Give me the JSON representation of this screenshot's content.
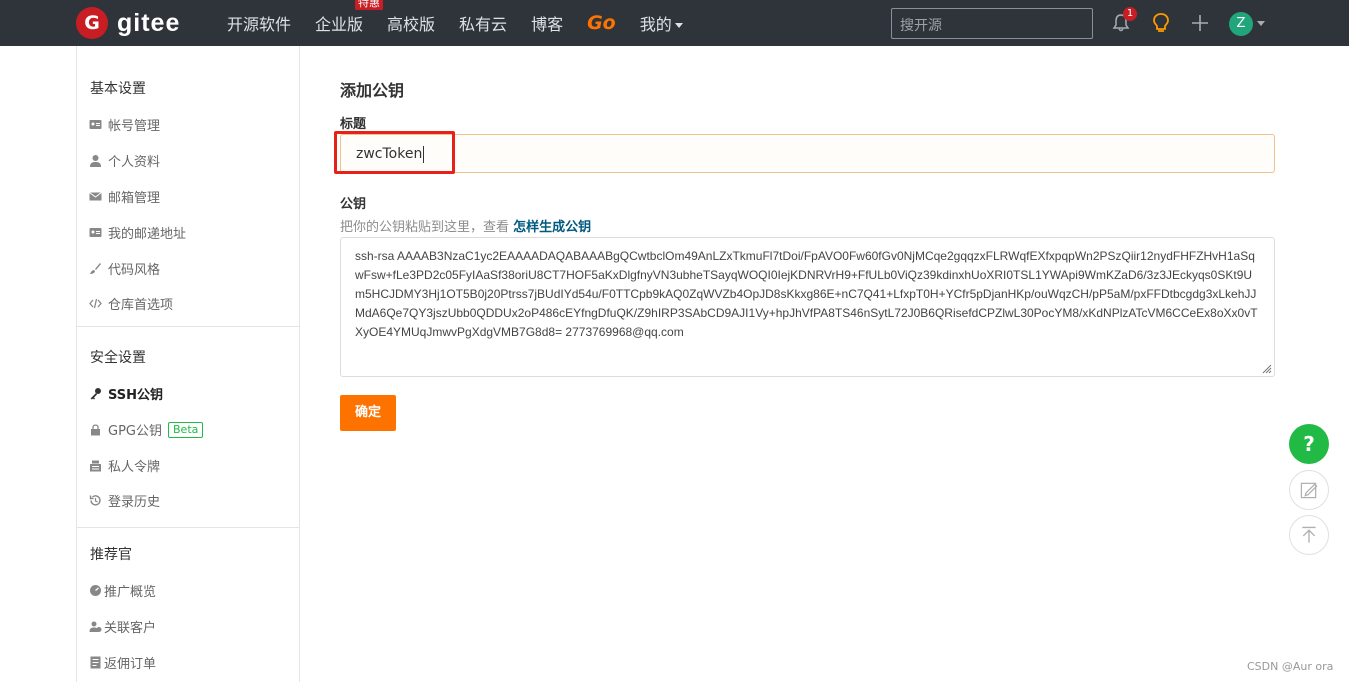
{
  "brand": {
    "name": "gitee"
  },
  "nav": {
    "items": [
      "开源软件",
      "企业版",
      "高校版",
      "私有云",
      "博客",
      "Go",
      "我的"
    ],
    "hot_badge": "特惠"
  },
  "search": {
    "placeholder": "搜开源"
  },
  "notifications": {
    "count": "1"
  },
  "user": {
    "avatar_letter": "Z"
  },
  "sidebar": {
    "basic": {
      "heading": "基本设置",
      "items": [
        {
          "label": "帐号管理",
          "icon": "id-card-icon"
        },
        {
          "label": "个人资料",
          "icon": "user-icon"
        },
        {
          "label": "邮箱管理",
          "icon": "mail-icon"
        },
        {
          "label": "我的邮递地址",
          "icon": "address-card-icon"
        },
        {
          "label": "代码风格",
          "icon": "brush-icon"
        },
        {
          "label": "仓库首选项",
          "icon": "code-icon"
        }
      ]
    },
    "security": {
      "heading": "安全设置",
      "items": [
        {
          "label": "SSH公钥",
          "icon": "key-icon",
          "active": true
        },
        {
          "label": "GPG公钥",
          "icon": "lock-icon",
          "badge": "Beta"
        },
        {
          "label": "私人令牌",
          "icon": "token-icon"
        },
        {
          "label": "登录历史",
          "icon": "history-icon"
        }
      ]
    },
    "referral": {
      "heading": "推荐官",
      "items": [
        {
          "label": "推广概览",
          "icon": "dashboard-icon"
        },
        {
          "label": "关联客户",
          "icon": "users-icon"
        },
        {
          "label": "返佣订单",
          "icon": "order-icon"
        }
      ]
    }
  },
  "form": {
    "heading": "添加公钥",
    "title_label": "标题",
    "title_value": "zwcToken",
    "key_label": "公钥",
    "hint_text": "把你的公钥粘贴到这里，查看",
    "hint_link": "怎样生成公钥",
    "key_value": "ssh-rsa AAAAB3NzaC1yc2EAAAADAQABAAABgQCwtbclOm49AnLZxTkmuFl7tDoi/FpAVO0Fw60fGv0NjMCqe2gqqzxFLRWqfEXfxpqpWn2PSzQiir12nydFHFZHvH1aSqwFsw+fLe3PD2c05FyIAaSf38oriU8CT7HOF5aKxDlgfnyVN3ubheTSayqWOQI0IejKDNRVrH9+FfULb0ViQz39kdinxhUoXRI0TSL1YWApi9WmKZaD6/3z3JEckyqs0SKt9Um5HCJDMY3Hj1OT5B0j20Ptrss7jBUdIYd54u/F0TTCpb9kAQ0ZqWVZb4OpJD8sKkxg86E+nC7Q41+LfxpT0H+YCfr5pDjanHKp/ouWqzCH/pP5aM/pxFFDtbcgdg3xLkehJJMdA6Qe7QY3jszUbb0QDDUx2oP486cEYfngDfuQK/Z9hIRP3SAbCD9AJI1Vy+hpJhVfPA8TS46nSytL72J0B6QRisefdCPZlwL30PocYM8/xKdNPlzATcVM6CCeEx8oXx0vTXyOE4YMUqJmwvPgXdgVMB7G8d8= 2773769968@qq.com",
    "confirm_label": "确定"
  },
  "floating": {
    "help": "?"
  },
  "watermark": "CSDN @Aur ora",
  "colors": {
    "accent": "#fe7300",
    "highlight": "#e8201a",
    "brand": "#c71d23",
    "green": "#21ba45"
  }
}
